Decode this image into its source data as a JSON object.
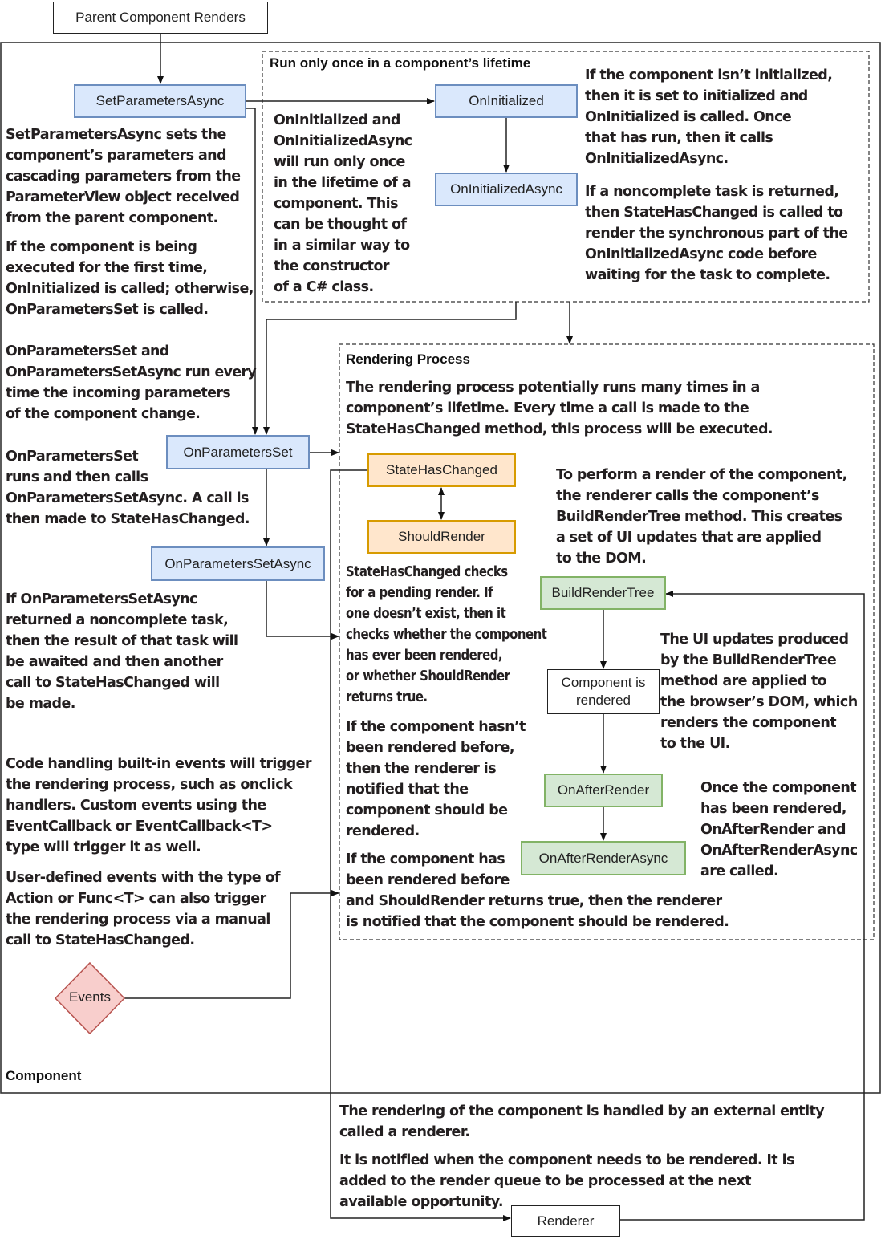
{
  "nodes": {
    "parent_renders": "Parent Component Renders",
    "set_parameters_async": "SetParametersAsync",
    "on_initialized": "OnInitialized",
    "on_initialized_async": "OnInitializedAsync",
    "on_parameters_set": "OnParametersSet",
    "on_parameters_set_async": "OnParametersSetAsync",
    "state_has_changed": "StateHasChanged",
    "should_render": "ShouldRender",
    "build_render_tree": "BuildRenderTree",
    "component_is_rendered": "Component is\nrendered",
    "on_after_render": "OnAfterRender",
    "on_after_render_async": "OnAfterRenderAsync",
    "events": "Events",
    "renderer": "Renderer"
  },
  "groups": {
    "component": "Component",
    "run_once": "Run only once in a component’s lifetime",
    "rendering_process": "Rendering Process"
  },
  "notes": {
    "set_parameters_async": "SetParametersAsync sets the\ncomponent’s parameters and\ncascading parameters from the\nParameterView object received\nfrom the parent component.",
    "first_time": "If the component is being\nexecuted for the first time,\nOnInitialized is called; otherwise,\nOnParametersSet is called.",
    "parameters_set_every_time": "OnParametersSet and\nOnParametersSetAsync run every\ntime the incoming parameters\nof the component change.",
    "parameters_set_runs": "OnParametersSet\nruns and then calls\nOnParametersSetAsync. A call is\nthen made to StateHasChanged.",
    "parameters_set_async_noncomplete": "If OnParametersSetAsync\nreturned a noncomplete task,\nthen the result of that task will\nbe awaited and then another\ncall to StateHasChanged will\nbe made.",
    "built_in_events": "Code handling built-in events will trigger\nthe rendering process, such as onclick\nhandlers. Custom events using the\nEventCallback or EventCallback<T>\ntype will trigger it as well.",
    "user_defined_events": "User-defined events with the type of\nAction or Func<T> can also trigger\nthe rendering process via a manual\ncall to StateHasChanged.",
    "run_once_explain": "OnInitialized and\nOnInitializedAsync\nwill run only once\nin the lifetime of a\ncomponent. This\ncan be thought of\nin a similar way to\nthe constructor\nof a C# class.",
    "not_initialized": "If the component isn’t initialized,\nthen it is set to initialized and\nOnInitialized is called. Once\nthat has run, then it calls\nOnInitializedAsync.",
    "noncomplete_task": "If a noncomplete task is returned,\nthen StateHasChanged is called to\nrender the synchronous part of the\nOnInitializedAsync code before\nwaiting for the task to complete.",
    "rendering_process_intro": "The rendering process potentially runs many times in a\ncomponent’s lifetime. Every time a call is made to the\nStateHasChanged method, this process will be executed.",
    "perform_render": "To perform a render of the component,\nthe renderer calls the component’s\nBuildRenderTree method. This creates\na set of UI updates that are applied\nto the DOM.",
    "state_has_changed_checks": "StateHasChanged checks\nfor a pending render. If\none doesn’t exist, then it\nchecks whether the component\nhas ever been rendered,\nor whether ShouldRender\nreturns true.",
    "ui_updates": "The UI updates produced\nby the BuildRenderTree\nmethod are applied to\nthe browser’s DOM, which\nrenders the component\nto the UI.",
    "not_rendered_before": "If the component hasn’t\nbeen rendered before,\nthen the renderer is\nnotified that the\ncomponent should be\nrendered.",
    "once_rendered": "Once the component\nhas been rendered,\nOnAfterRender and\nOnAfterRenderAsync\nare called.",
    "rendered_before": "If the component has\nbeen rendered before\nand ShouldRender returns true, then the renderer\nis notified that the component should be rendered.",
    "renderer_external": "The rendering of the component is handled by an external entity\ncalled a renderer.",
    "renderer_queue": "It is notified when the component needs to be rendered. It is\nadded to the render queue to be processed at the next\navailable opportunity."
  },
  "colors": {
    "blue_fill": "#dae8fc",
    "blue_stroke": "#6c8ebf",
    "orange_fill": "#ffe6cc",
    "orange_stroke": "#d79b00",
    "green_fill": "#d5e8d4",
    "green_stroke": "#82b366",
    "red_fill": "#f8cecc",
    "red_stroke": "#b85450"
  }
}
